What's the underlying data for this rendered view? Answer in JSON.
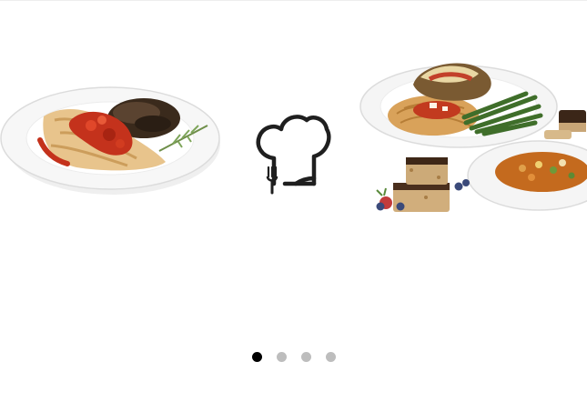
{
  "colors": {
    "background": "#ffffff",
    "logo": "#1f1f1f",
    "dot_active": "#000000",
    "dot_inactive": "#bdbdbd"
  },
  "hero": {
    "images": [
      {
        "name": "grilled-chicken-plate",
        "description_icon": "plate-chicken-wild-rice"
      },
      {
        "name": "meal-assortment",
        "description_icon": "plates-parmesan-bars-soup"
      }
    ],
    "logo_icon": "chef-hat-fork-icon"
  },
  "pagination": {
    "count": 4,
    "active_index": 0
  }
}
